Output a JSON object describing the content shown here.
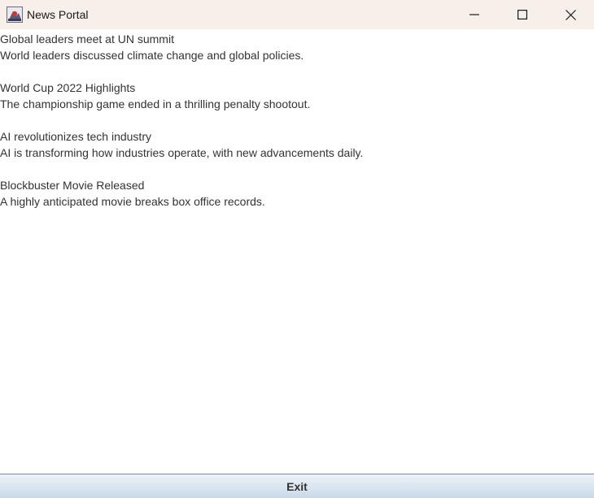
{
  "window": {
    "title": "News Portal",
    "icon": "java-app-icon"
  },
  "controls": {
    "minimize_icon": "minimize-icon",
    "maximize_icon": "maximize-icon",
    "close_icon": "close-icon"
  },
  "news": [
    {
      "title": "Global leaders meet at UN summit",
      "description": "World leaders discussed climate change and global policies."
    },
    {
      "title": "World Cup 2022 Highlights",
      "description": "The championship game ended in a thrilling penalty shootout."
    },
    {
      "title": "AI revolutionizes tech industry",
      "description": "AI is transforming how industries operate, with new advancements daily."
    },
    {
      "title": "Blockbuster Movie Released",
      "description": "A highly anticipated movie breaks box office records."
    }
  ],
  "footer": {
    "exit_label": "Exit"
  },
  "colors": {
    "titlebar": "#f7efea",
    "text": "#333333",
    "button_gradient_top": "#eef3f8",
    "button_gradient_bottom": "#c9d8e8"
  }
}
